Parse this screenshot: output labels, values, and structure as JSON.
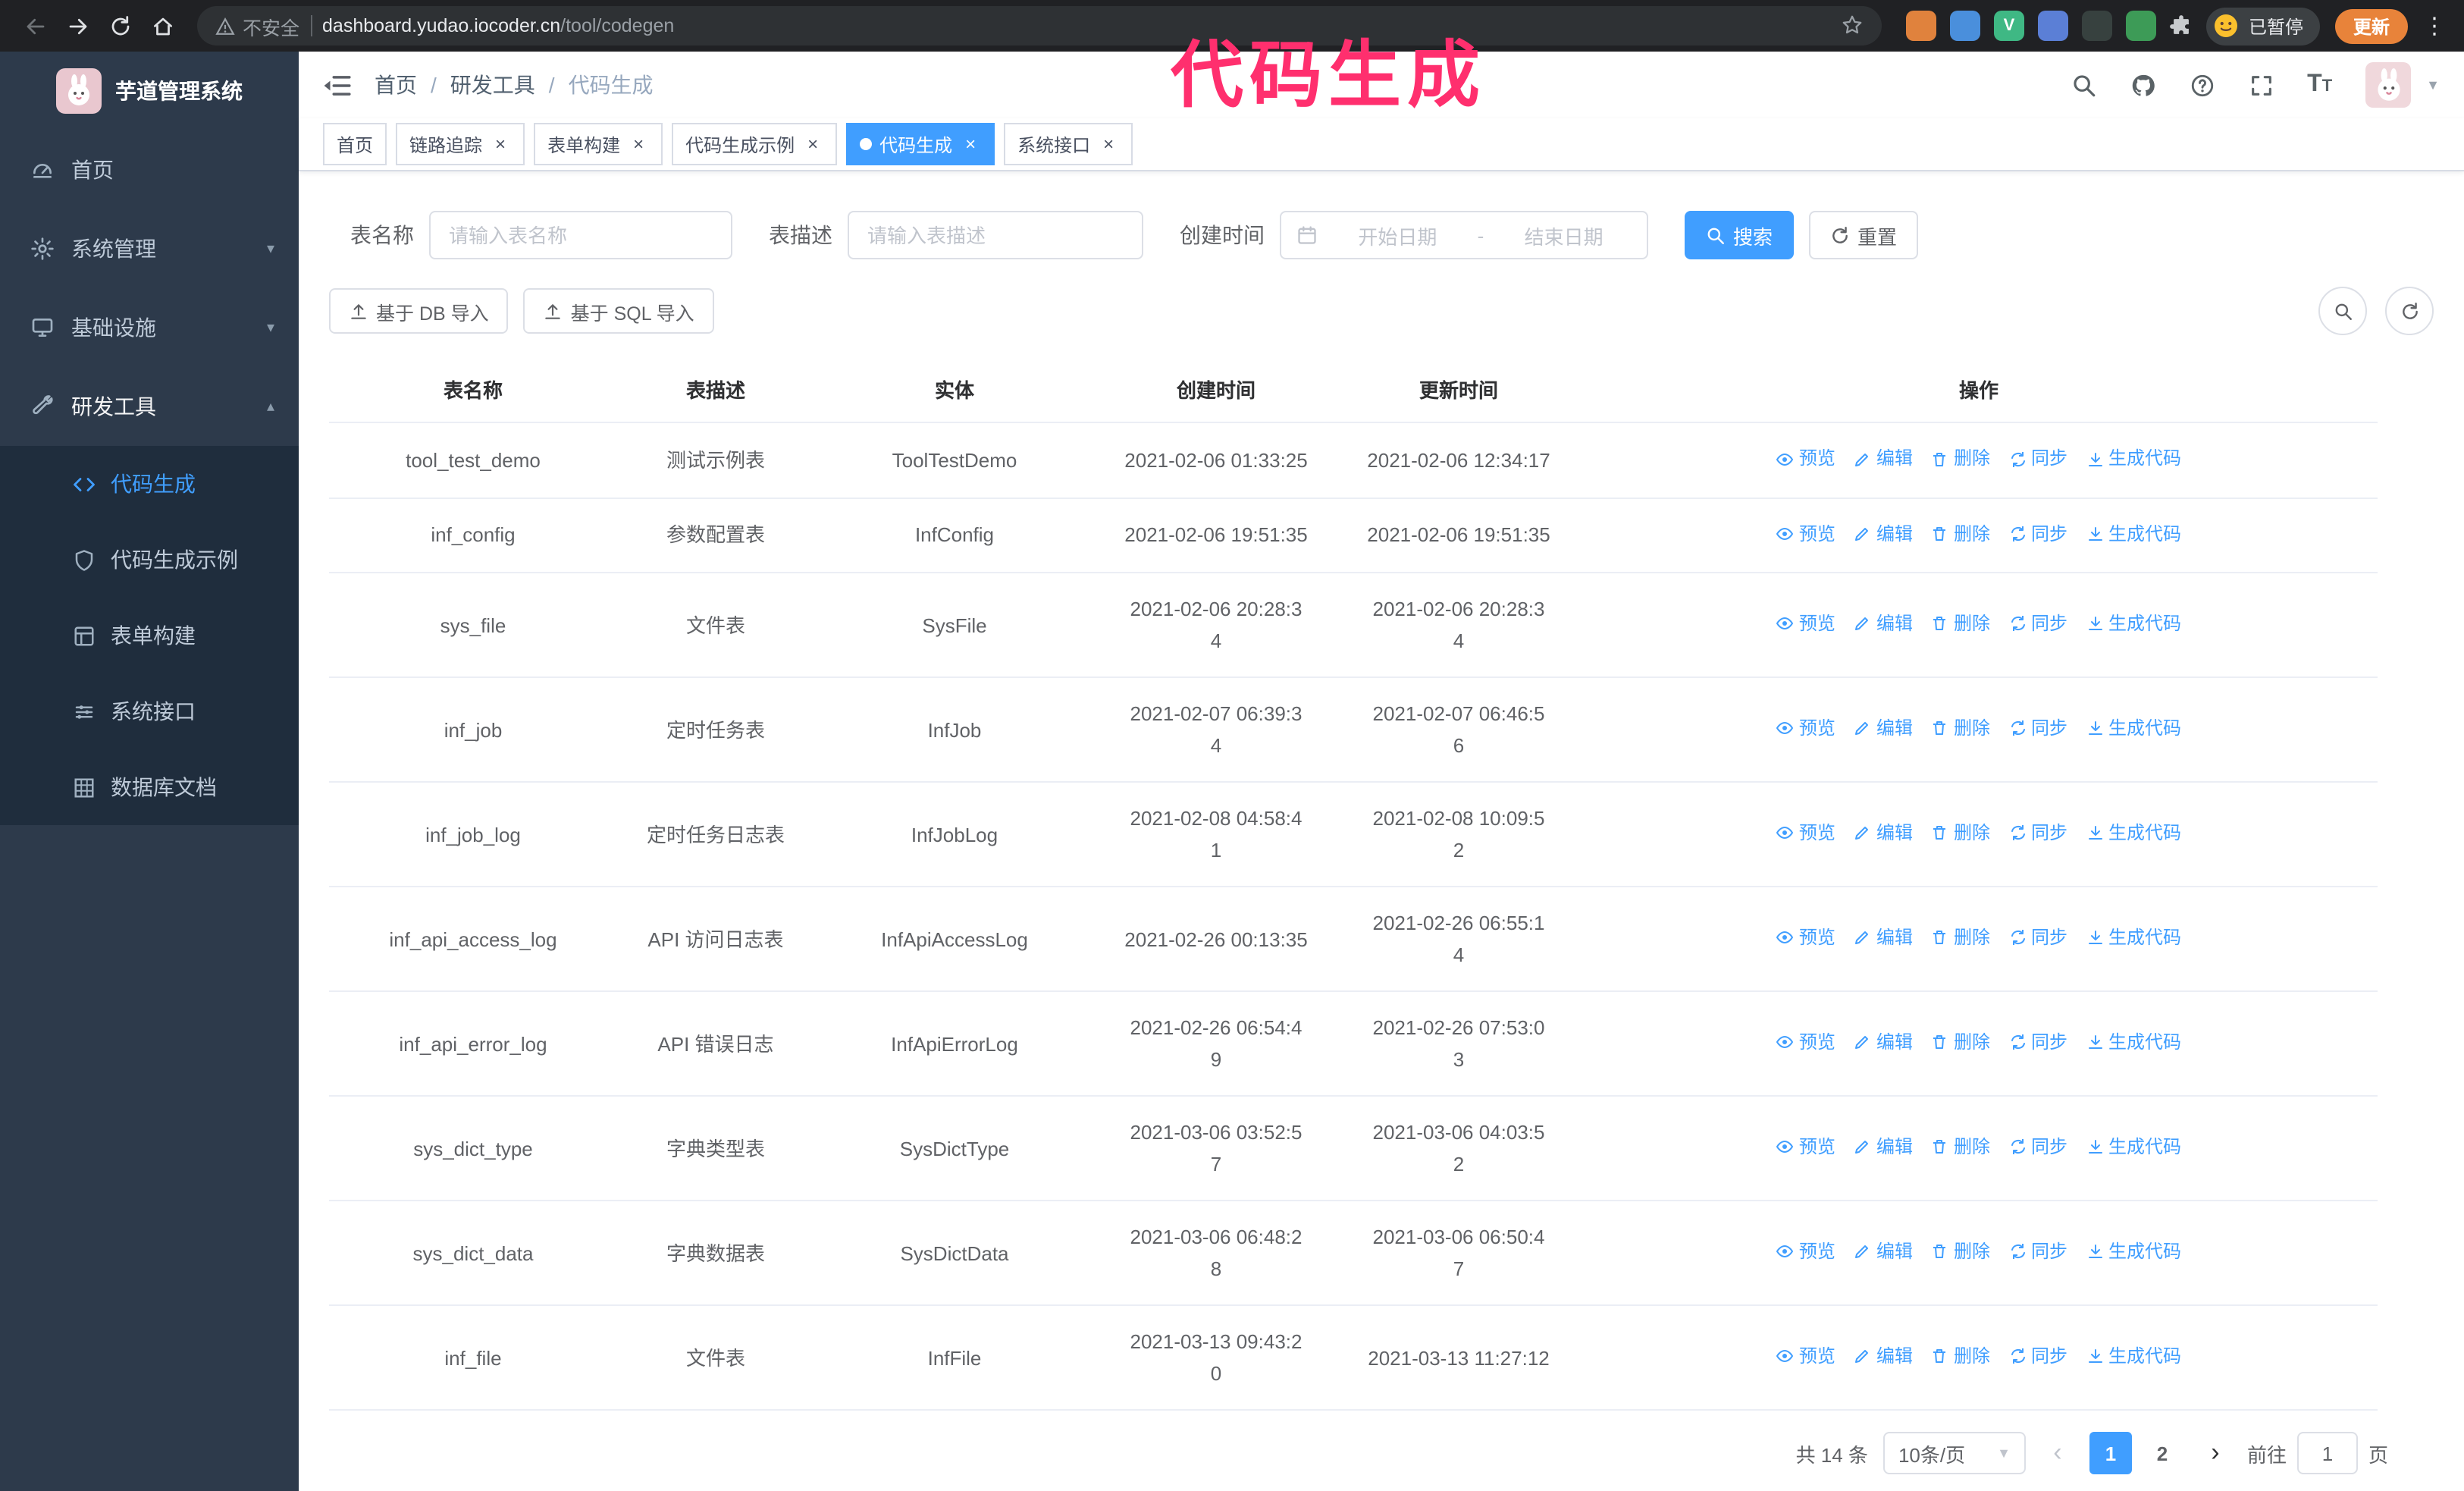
{
  "colors": {
    "primary": "#409eff",
    "annotation": "#ff2f6e",
    "sidebar": "#2d3a4b",
    "submenu": "#1f2d3d"
  },
  "annotation": {
    "title": "代码生成"
  },
  "browser": {
    "security_text": "不安全",
    "url_host": "dashboard.yudao.iocoder.cn",
    "url_path": "/tool/codegen",
    "paused_badge": "已暂停",
    "update_button": "更新",
    "menu_icon": "⋮",
    "extensions": [
      {
        "name": "extension-orange-icon",
        "color": "#e0823d",
        "glyph": ""
      },
      {
        "name": "extension-blue-icon",
        "color": "#4a8fdc",
        "glyph": ""
      },
      {
        "name": "extension-vue-devtools-icon",
        "color": "#3fb884",
        "glyph": "V"
      },
      {
        "name": "extension-people-icon",
        "color": "#5b7fd6",
        "glyph": ""
      },
      {
        "name": "extension-dark-icon",
        "color": "#37413f",
        "glyph": ""
      },
      {
        "name": "extension-green-icon",
        "color": "#3d9b57",
        "glyph": ""
      }
    ]
  },
  "sidebar": {
    "logo_title": "芋道管理系统",
    "items": [
      {
        "key": "home",
        "label": "首页",
        "icon": "gauge"
      },
      {
        "key": "system",
        "label": "系统管理",
        "icon": "gear",
        "chevron": "down"
      },
      {
        "key": "infrastructure",
        "label": "基础设施",
        "icon": "monitor",
        "chevron": "down"
      },
      {
        "key": "dev-tools",
        "label": "研发工具",
        "icon": "tools",
        "chevron": "up",
        "expanded": true
      }
    ],
    "submenu": [
      {
        "key": "codegen",
        "label": "代码生成",
        "icon": "code",
        "active": true
      },
      {
        "key": "codegen-example",
        "label": "代码生成示例",
        "icon": "shield"
      },
      {
        "key": "form-builder",
        "label": "表单构建",
        "icon": "form"
      },
      {
        "key": "system-api",
        "label": "系统接口",
        "icon": "sliders"
      },
      {
        "key": "db-doc",
        "label": "数据库文档",
        "icon": "grid"
      }
    ]
  },
  "header": {
    "breadcrumb": [
      "首页",
      "研发工具",
      "代码生成"
    ],
    "separator": "/",
    "font_icon_big": "T",
    "font_icon_small": "T"
  },
  "tabs": [
    {
      "key": "home",
      "label": "首页",
      "closable": false
    },
    {
      "key": "tracer",
      "label": "链路追踪",
      "closable": true
    },
    {
      "key": "form-builder",
      "label": "表单构建",
      "closable": true
    },
    {
      "key": "codegen-example",
      "label": "代码生成示例",
      "closable": true
    },
    {
      "key": "codegen",
      "label": "代码生成",
      "closable": true,
      "active": true
    },
    {
      "key": "system-api",
      "label": "系统接口",
      "closable": true
    }
  ],
  "filters": {
    "table_name_label": "表名称",
    "table_name_placeholder": "请输入表名称",
    "table_desc_label": "表描述",
    "table_desc_placeholder": "请输入表描述",
    "create_time_label": "创建时间",
    "date_start_placeholder": "开始日期",
    "date_separator": "-",
    "date_end_placeholder": "结束日期",
    "search_button": "搜索",
    "reset_button": "重置"
  },
  "toolbar": {
    "import_db": "基于 DB 导入",
    "import_sql": "基于 SQL 导入"
  },
  "table": {
    "columns": [
      "表名称",
      "表描述",
      "实体",
      "创建时间",
      "更新时间",
      "操作"
    ],
    "actions": [
      {
        "label": "预览",
        "icon": "eye"
      },
      {
        "label": "编辑",
        "icon": "edit"
      },
      {
        "label": "删除",
        "icon": "trash"
      },
      {
        "label": "同步",
        "icon": "sync"
      },
      {
        "label": "生成代码",
        "icon": "download"
      }
    ],
    "rows": [
      {
        "name": "tool_test_demo",
        "desc": "测试示例表",
        "entity": "ToolTestDemo",
        "created": "2021-02-06 01:33:25",
        "updated": "2021-02-06 12:34:17"
      },
      {
        "name": "inf_config",
        "desc": "参数配置表",
        "entity": "InfConfig",
        "created": "2021-02-06 19:51:35",
        "updated": "2021-02-06 19:51:35"
      },
      {
        "name": "sys_file",
        "desc": "文件表",
        "entity": "SysFile",
        "created": "2021-02-06 20:28:3\n4",
        "updated": "2021-02-06 20:28:3\n4"
      },
      {
        "name": "inf_job",
        "desc": "定时任务表",
        "entity": "InfJob",
        "created": "2021-02-07 06:39:3\n4",
        "updated": "2021-02-07 06:46:5\n6"
      },
      {
        "name": "inf_job_log",
        "desc": "定时任务日志表",
        "entity": "InfJobLog",
        "created": "2021-02-08 04:58:4\n1",
        "updated": "2021-02-08 10:09:5\n2"
      },
      {
        "name": "inf_api_access_log",
        "desc": "API 访问日志表",
        "entity": "InfApiAccessLog",
        "created": "2021-02-26 00:13:35",
        "updated": "2021-02-26 06:55:1\n4"
      },
      {
        "name": "inf_api_error_log",
        "desc": "API 错误日志",
        "entity": "InfApiErrorLog",
        "created": "2021-02-26 06:54:4\n9",
        "updated": "2021-02-26 07:53:0\n3"
      },
      {
        "name": "sys_dict_type",
        "desc": "字典类型表",
        "entity": "SysDictType",
        "created": "2021-03-06 03:52:5\n7",
        "updated": "2021-03-06 04:03:5\n2"
      },
      {
        "name": "sys_dict_data",
        "desc": "字典数据表",
        "entity": "SysDictData",
        "created": "2021-03-06 06:48:2\n8",
        "updated": "2021-03-06 06:50:4\n7"
      },
      {
        "name": "inf_file",
        "desc": "文件表",
        "entity": "InfFile",
        "created": "2021-03-13 09:43:2\n0",
        "updated": "2021-03-13 11:27:12"
      }
    ]
  },
  "pagination": {
    "total": "共 14 条",
    "page_size": "10条/页",
    "prev": "‹",
    "next": "›",
    "pages": [
      "1",
      "2"
    ],
    "current": "1",
    "goto_label": "前往",
    "goto_value": "1",
    "goto_suffix": "页"
  }
}
